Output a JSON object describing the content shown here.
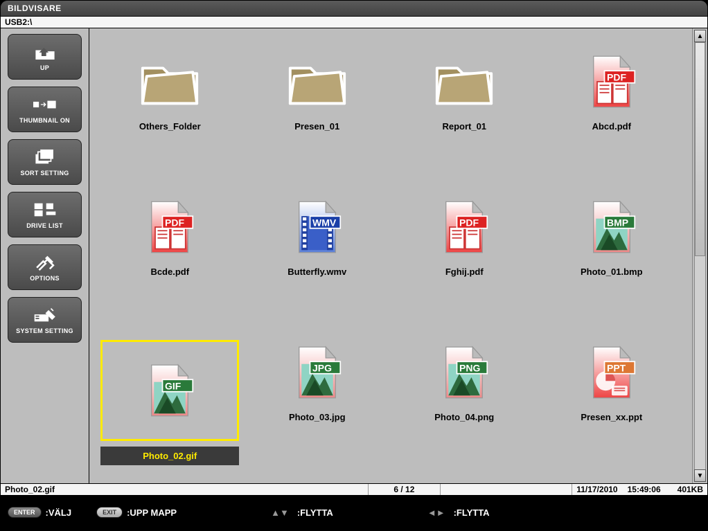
{
  "app_title": "BILDVISARE",
  "path": "USB2:\\",
  "sidebar": [
    {
      "id": "up",
      "label": "UP"
    },
    {
      "id": "thumbnail",
      "label": "THUMBNAIL ON"
    },
    {
      "id": "sort",
      "label": "SORT SETTING"
    },
    {
      "id": "drive",
      "label": "DRIVE LIST"
    },
    {
      "id": "options",
      "label": "OPTIONS"
    },
    {
      "id": "system",
      "label": "SYSTEM SETTING"
    }
  ],
  "items": [
    {
      "name": "Others_Folder",
      "type": "folder",
      "selected": false
    },
    {
      "name": "Presen_01",
      "type": "folder",
      "selected": false
    },
    {
      "name": "Report_01",
      "type": "folder",
      "selected": false
    },
    {
      "name": "Abcd.pdf",
      "type": "pdf",
      "selected": false
    },
    {
      "name": "Bcde.pdf",
      "type": "pdf",
      "selected": false
    },
    {
      "name": "Butterfly.wmv",
      "type": "wmv",
      "selected": false
    },
    {
      "name": "Fghij.pdf",
      "type": "pdf",
      "selected": false
    },
    {
      "name": "Photo_01.bmp",
      "type": "bmp",
      "selected": false
    },
    {
      "name": "Photo_02.gif",
      "type": "gif",
      "selected": true
    },
    {
      "name": "Photo_03.jpg",
      "type": "jpg",
      "selected": false
    },
    {
      "name": "Photo_04.png",
      "type": "png",
      "selected": false
    },
    {
      "name": "Presen_xx.ppt",
      "type": "ppt",
      "selected": false
    }
  ],
  "status": {
    "selected_name": "Photo_02.gif",
    "count": "6 / 12",
    "date": "11/17/2010",
    "time": "15:49:06",
    "size": "401KB"
  },
  "footer": {
    "enter_key": "ENTER",
    "enter_label": ":VÄLJ",
    "exit_key": "EXIT",
    "exit_label": ":UPP MAPP",
    "updown_label": ":FLYTTA",
    "leftright_label": ":FLYTTA"
  },
  "badges": {
    "pdf": "PDF",
    "wmv": "WMV",
    "bmp": "BMP",
    "gif": "GIF",
    "jpg": "JPG",
    "png": "PNG",
    "ppt": "PPT"
  }
}
